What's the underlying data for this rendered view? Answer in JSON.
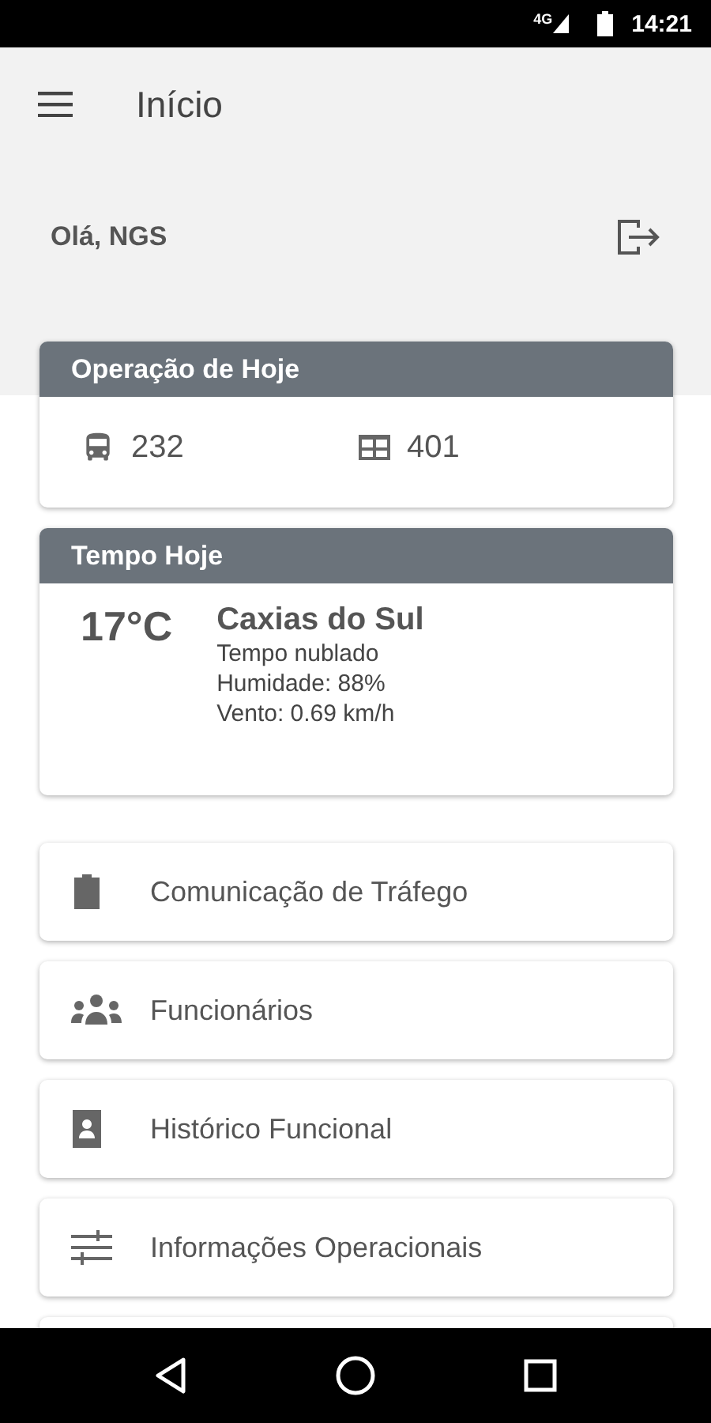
{
  "status_bar": {
    "network": "4G",
    "time": "14:21"
  },
  "app_bar": {
    "title": "Início"
  },
  "greeting": "Olá, NGS",
  "operation_card": {
    "title": "Operação de Hoje",
    "stats": [
      {
        "value": "232"
      },
      {
        "value": "401"
      }
    ]
  },
  "weather_card": {
    "title": "Tempo Hoje",
    "temperature": "17°C",
    "city": "Caxias do Sul",
    "details": [
      "Tempo nublado",
      "Humidade: 88%",
      "Vento: 0.69 km/h"
    ]
  },
  "menu": [
    {
      "label": "Comunicação de Tráfego"
    },
    {
      "label": "Funcionários"
    },
    {
      "label": "Histórico Funcional"
    },
    {
      "label": "Informações Operacionais"
    }
  ]
}
